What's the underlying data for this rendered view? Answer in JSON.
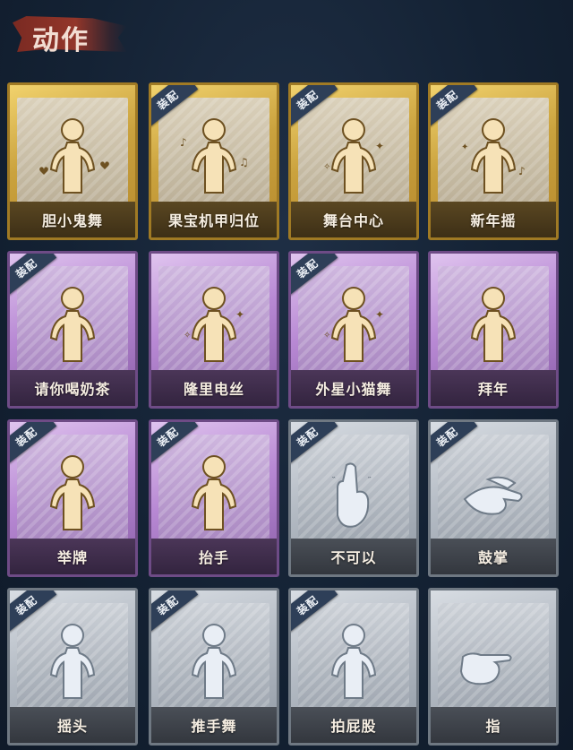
{
  "header": {
    "title": "动作"
  },
  "badge_label": "装配",
  "cards": [
    {
      "name": "胆小鬼舞",
      "tier": "gold",
      "equipped": false,
      "icon": "figure-hearts-icon"
    },
    {
      "name": "果宝机甲归位",
      "tier": "gold",
      "equipped": true,
      "icon": "figure-music-notes-icon"
    },
    {
      "name": "舞台中心",
      "tier": "gold",
      "equipped": true,
      "icon": "figure-sparkles-icon"
    },
    {
      "name": "新年摇",
      "tier": "gold",
      "equipped": true,
      "icon": "figure-clasped-hands-icon"
    },
    {
      "name": "请你喝奶茶",
      "tier": "purple",
      "equipped": true,
      "icon": "figure-holding-sign-icon"
    },
    {
      "name": "隆里电丝",
      "tier": "purple",
      "equipped": false,
      "icon": "figure-pointing-icon"
    },
    {
      "name": "外星小猫舞",
      "tier": "purple",
      "equipped": true,
      "icon": "figure-dancing-icon"
    },
    {
      "name": "拜年",
      "tier": "purple",
      "equipped": false,
      "icon": "figure-greeting-icon"
    },
    {
      "name": "举牌",
      "tier": "purple",
      "equipped": true,
      "icon": "figure-placard-icon"
    },
    {
      "name": "抬手",
      "tier": "purple",
      "equipped": true,
      "icon": "figure-raise-hand-icon"
    },
    {
      "name": "不可以",
      "tier": "silver",
      "equipped": true,
      "icon": "finger-wag-icon"
    },
    {
      "name": "鼓掌",
      "tier": "silver",
      "equipped": true,
      "icon": "clapping-hands-icon"
    },
    {
      "name": "摇头",
      "tier": "silver",
      "equipped": true,
      "icon": "figure-shake-head-icon"
    },
    {
      "name": "推手舞",
      "tier": "silver",
      "equipped": true,
      "icon": "figure-push-hands-icon"
    },
    {
      "name": "拍屁股",
      "tier": "silver",
      "equipped": true,
      "icon": "figure-bending-icon"
    },
    {
      "name": "指",
      "tier": "silver",
      "equipped": false,
      "icon": "pointing-hand-icon"
    }
  ],
  "colors": {
    "background": "#142234",
    "header_brush": "#93362a",
    "gold": "#caa23e",
    "purple": "#b889d4",
    "silver": "#b4bbc4",
    "badge": "#2e3f58"
  }
}
